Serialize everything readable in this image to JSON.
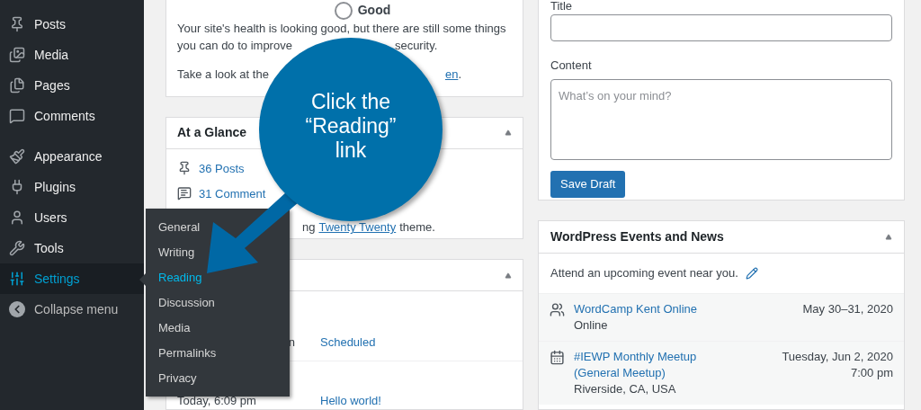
{
  "sidebar": {
    "groups": [
      [
        {
          "label": "Posts",
          "selected": false
        },
        {
          "label": "Media",
          "selected": false
        },
        {
          "label": "Pages",
          "selected": false
        },
        {
          "label": "Comments",
          "selected": false
        }
      ],
      [
        {
          "label": "Appearance",
          "selected": false
        },
        {
          "label": "Plugins",
          "selected": false
        },
        {
          "label": "Users",
          "selected": false
        },
        {
          "label": "Tools",
          "selected": false
        },
        {
          "label": "Settings",
          "selected": true
        }
      ]
    ],
    "collapse": "Collapse menu"
  },
  "submenu": {
    "items": [
      {
        "label": "General",
        "selected": false
      },
      {
        "label": "Writing",
        "selected": false
      },
      {
        "label": "Reading",
        "selected": true
      },
      {
        "label": "Discussion",
        "selected": false
      },
      {
        "label": "Media",
        "selected": false
      },
      {
        "label": "Permalinks",
        "selected": false
      },
      {
        "label": "Privacy",
        "selected": false
      }
    ]
  },
  "site_health": {
    "status": "Good",
    "line_1": "Your site's health is looking good, but there are still some things",
    "line_2_start": "you can do to improve",
    "line_2_end": "security.",
    "line_3_start": "Take a look at the",
    "line_3_link": "en",
    "line_3_end": "."
  },
  "at_a_glance": {
    "title": "At a Glance",
    "posts": "36 Posts",
    "comments": "31 Comment",
    "theme_start": "ng",
    "theme_link": "Twenty Twenty",
    "theme_end": "theme."
  },
  "activity": {
    "scheduled_row": {
      "column_1": "n",
      "column_2": "Scheduled"
    },
    "today_row": {
      "column_1": "Today, 6:09 pm",
      "column_2": "Hello world!"
    }
  },
  "quick_draft": {
    "title_label": "Title",
    "content_label": "Content",
    "content_placeholder": "What’s on your mind?",
    "button": "Save Draft"
  },
  "events": {
    "title": "WordPress Events and News",
    "intro": "Attend an upcoming event near you.",
    "items": [
      {
        "kind": "wordcamp",
        "name": "WordCamp Kent Online",
        "location": "Online",
        "date": "May 30–31, 2020"
      },
      {
        "kind": "meetup",
        "name": "#IEWP Monthly Meetup (General Meetup)",
        "location": "Riverside, CA, USA",
        "date": "Tuesday, Jun 2, 2020",
        "time": "7:00 pm"
      }
    ]
  },
  "callout": {
    "text": "Click the “Reading” link"
  }
}
